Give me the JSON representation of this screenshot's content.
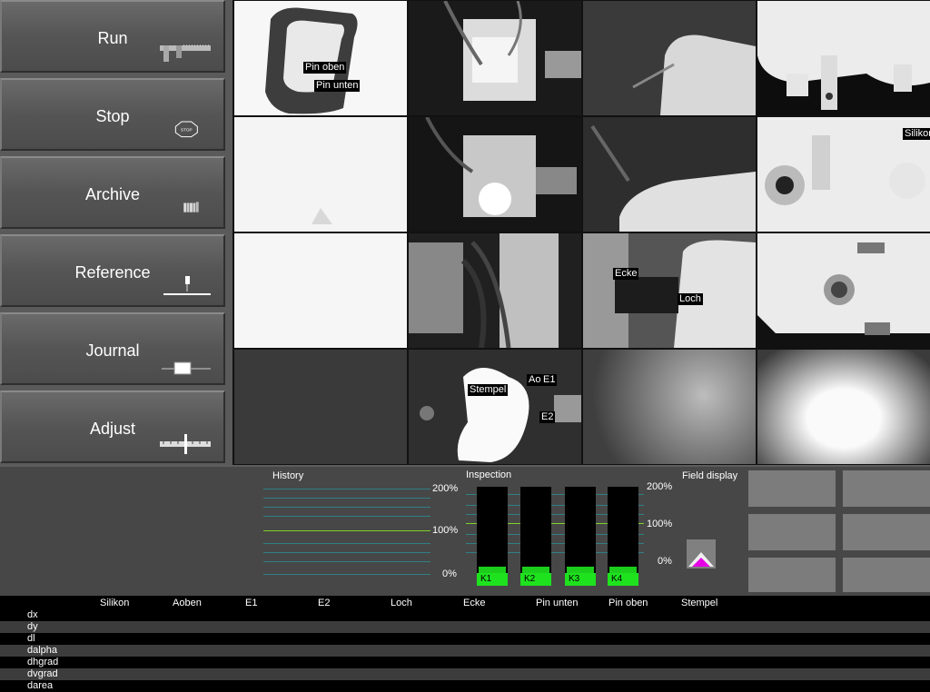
{
  "nav": {
    "run": "Run",
    "stop": "Stop",
    "archive": "Archive",
    "reference": "Reference",
    "journal": "Journal",
    "adjust": "Adjust",
    "stop_sign_text": "STOP"
  },
  "camera_labels": {
    "pin_oben": "Pin oben",
    "pin_unten": "Pin unten",
    "silikon": "Silikon",
    "ecke": "Ecke",
    "loch": "Loch",
    "stempel": "Stempel",
    "aoben": "Aob",
    "e1": "E1",
    "e2": "E2"
  },
  "history": {
    "title": "History",
    "pct_200": "200%",
    "pct_100": "100%",
    "pct_0": "0%"
  },
  "inspection": {
    "title": "Inspection",
    "pct_200": "200%",
    "pct_100": "100%",
    "pct_0": "0%",
    "bars": [
      {
        "label": "K1",
        "level": 0.08
      },
      {
        "label": "K2",
        "level": 0.08
      },
      {
        "label": "K3",
        "level": 0.08
      },
      {
        "label": "K4",
        "level": 0.08
      }
    ]
  },
  "field_display": {
    "title": "Field display"
  },
  "table": {
    "columns": [
      "Silikon",
      "Aoben",
      "E1",
      "E2",
      "Loch",
      "Ecke",
      "Pin unten",
      "Pin oben",
      "Stempel"
    ],
    "rows": [
      "dx",
      "dy",
      "dl",
      "dalpha",
      "dhgrad",
      "dvgrad",
      "darea"
    ]
  },
  "colors": {
    "bar_green": "#1ccd1c",
    "grid_line": "#2f7f86",
    "center_line": "#7fd12a",
    "field_marker": "#e600e6"
  }
}
